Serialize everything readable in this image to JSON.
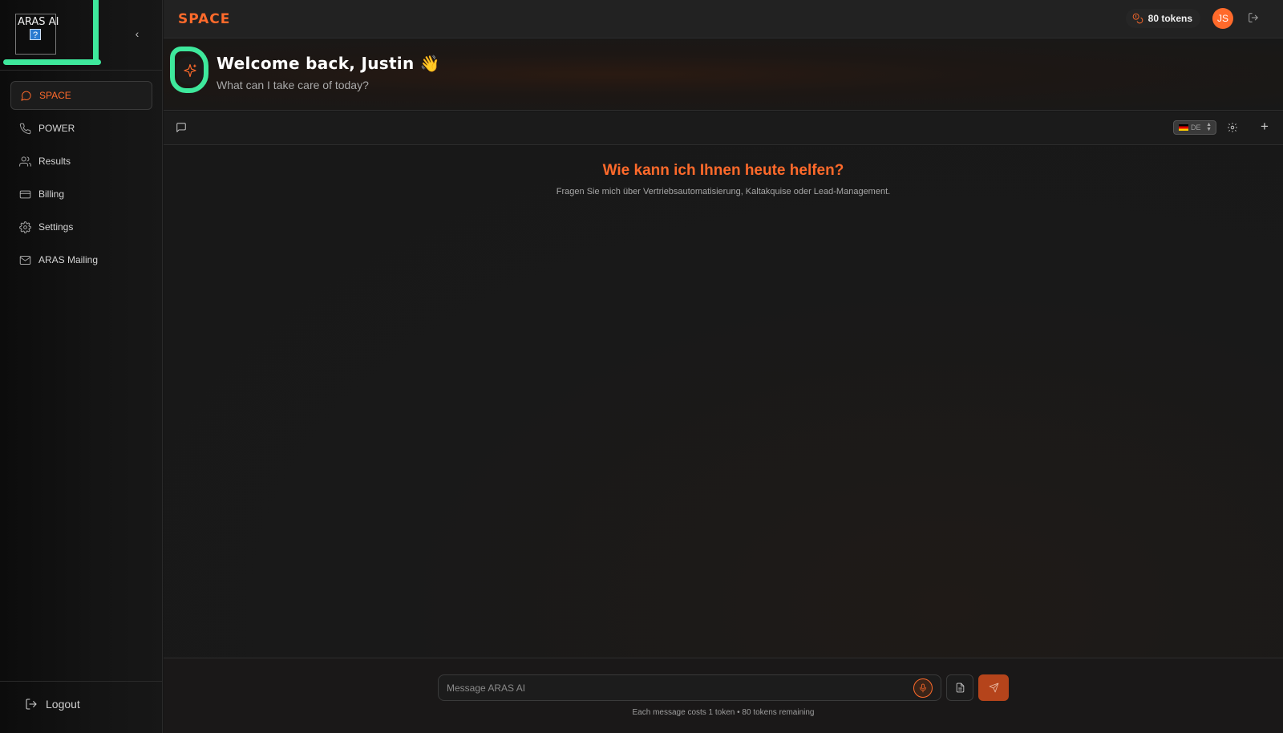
{
  "sidebar": {
    "logo_text": "ARAS AI",
    "logo_icon": "?",
    "collapse_icon": "‹",
    "items": [
      {
        "label": "SPACE",
        "icon": "message-circle-icon",
        "active": true
      },
      {
        "label": "POWER",
        "icon": "phone-icon",
        "active": false
      },
      {
        "label": "Results",
        "icon": "users-icon",
        "active": false
      },
      {
        "label": "Billing",
        "icon": "credit-card-icon",
        "active": false
      },
      {
        "label": "Settings",
        "icon": "gear-icon",
        "active": false
      },
      {
        "label": "ARAS Mailing",
        "icon": "mail-icon",
        "active": false
      }
    ],
    "logout_label": "Logout"
  },
  "topbar": {
    "brand": "SPACE",
    "tokens_label": "80 tokens",
    "avatar_initials": "JS"
  },
  "welcome": {
    "title": "Welcome back, Justin 👋",
    "subtitle": "What can I take care of today?"
  },
  "chat_toolbar": {
    "language": "DE"
  },
  "chat": {
    "title": "Wie kann ich Ihnen heute helfen?",
    "subtitle": "Fragen Sie mich über Vertriebsautomatisierung, Kaltakquise oder Lead-Management."
  },
  "composer": {
    "placeholder": "Message ARAS AI",
    "cost_note": "Each message costs 1 token • 80 tokens remaining"
  },
  "colors": {
    "accent": "#ff6a2b",
    "annotation": "#3ee89c"
  }
}
